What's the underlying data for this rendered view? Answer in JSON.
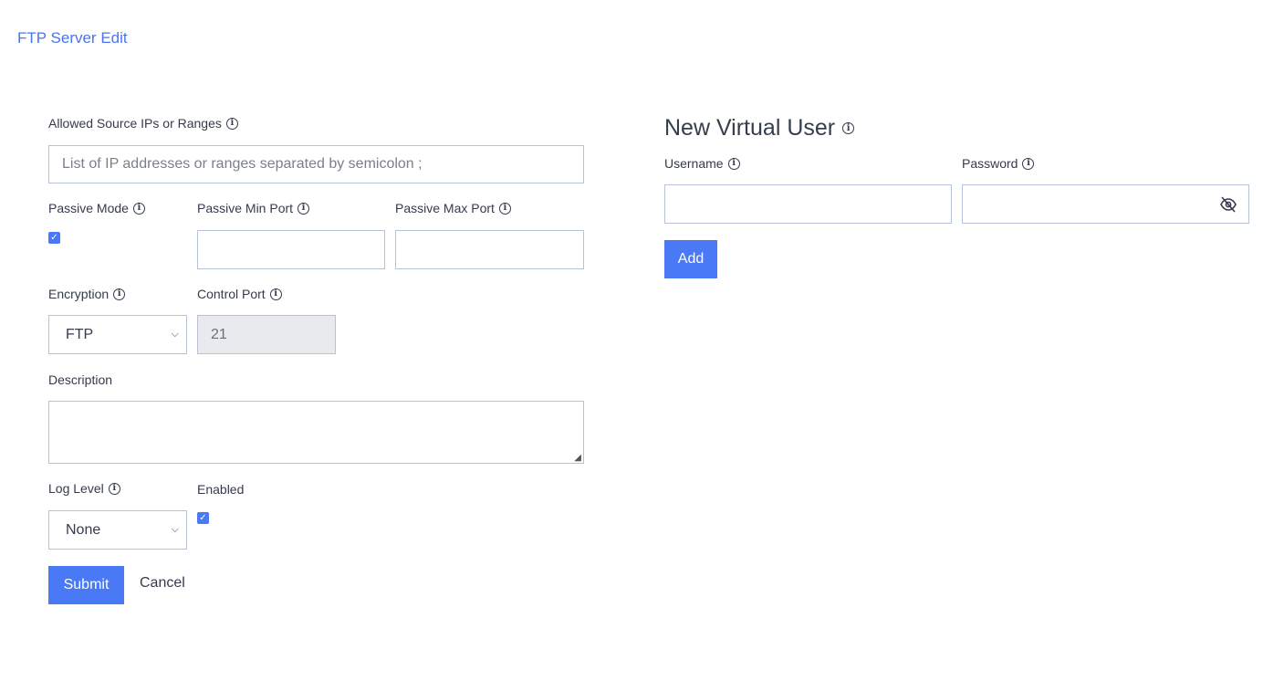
{
  "header": {
    "title": "FTP Server Edit"
  },
  "form": {
    "allowed_ips": {
      "label": "Allowed Source IPs or Ranges",
      "placeholder": "List of IP addresses or ranges separated by semicolon ;",
      "value": ""
    },
    "passive_mode": {
      "label": "Passive Mode",
      "checked": true
    },
    "passive_min_port": {
      "label": "Passive Min Port",
      "value": ""
    },
    "passive_max_port": {
      "label": "Passive Max Port",
      "value": ""
    },
    "encryption": {
      "label": "Encryption",
      "value": "FTP"
    },
    "control_port": {
      "label": "Control Port",
      "value": "21"
    },
    "description": {
      "label": "Description",
      "value": ""
    },
    "log_level": {
      "label": "Log Level",
      "value": "None"
    },
    "enabled": {
      "label": "Enabled",
      "checked": true
    },
    "submit_label": "Submit",
    "cancel_label": "Cancel"
  },
  "virtual_user": {
    "title": "New Virtual User",
    "username": {
      "label": "Username",
      "value": ""
    },
    "password": {
      "label": "Password",
      "value": ""
    },
    "add_label": "Add"
  },
  "colors": {
    "accent": "#4a79f5",
    "title": "#4a74ee"
  }
}
